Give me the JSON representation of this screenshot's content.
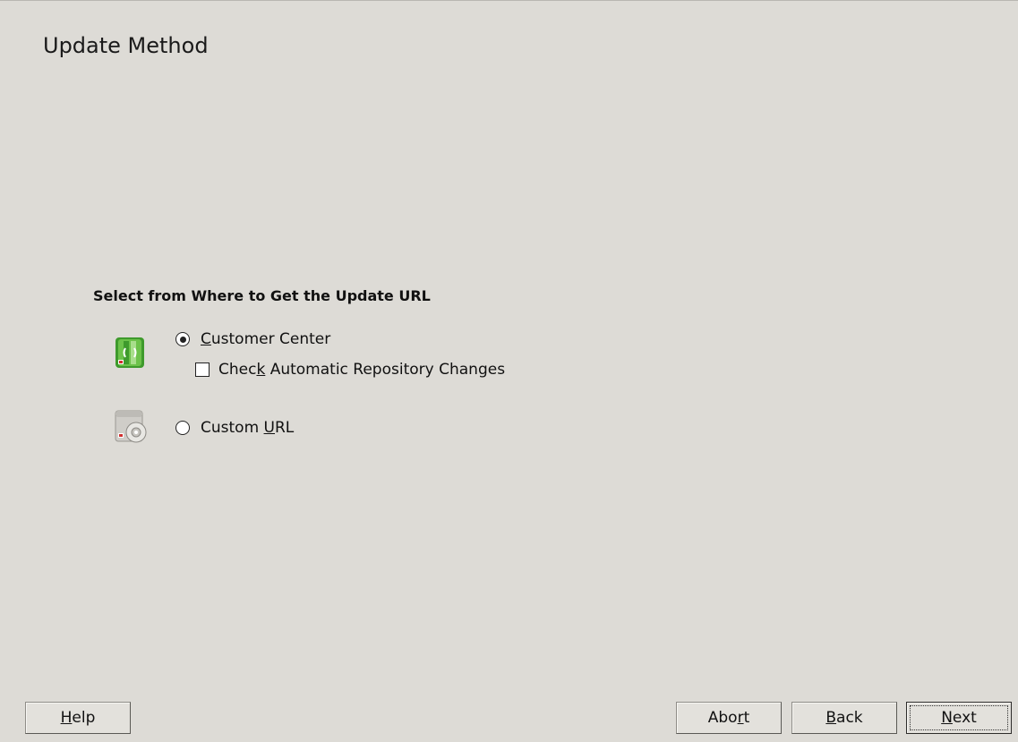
{
  "window": {
    "title": "Update Method"
  },
  "section": {
    "heading": "Select from Where to Get the Update URL"
  },
  "options": {
    "customer_center": {
      "pre": "",
      "key": "C",
      "post": "ustomer Center",
      "selected": true,
      "icon": "customer-center-icon"
    },
    "auto_repo": {
      "pre": "Chec",
      "key": "k",
      "post": " Automatic Repository Changes",
      "checked": false
    },
    "custom_url": {
      "pre": "Custom ",
      "key": "U",
      "post": "RL",
      "selected": false,
      "icon": "custom-url-icon"
    }
  },
  "buttons": {
    "help": {
      "pre": "",
      "key": "H",
      "post": "elp"
    },
    "abort": {
      "pre": "Abo",
      "key": "r",
      "post": "t"
    },
    "back": {
      "pre": "",
      "key": "B",
      "post": "ack"
    },
    "next": {
      "pre": "",
      "key": "N",
      "post": "ext"
    }
  },
  "colors": {
    "background": "#dddbd6",
    "icon_green": "#4aa636"
  }
}
